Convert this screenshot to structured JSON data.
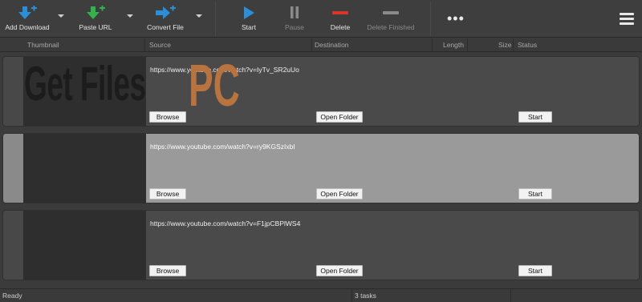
{
  "toolbar": {
    "add_download": "Add Download",
    "paste_url": "Paste URL",
    "convert_file": "Convert File",
    "start": "Start",
    "pause": "Pause",
    "delete": "Delete",
    "delete_finished": "Delete Finished",
    "more_icon": "more-dots-icon",
    "menu_icon": "hamburger-menu-icon",
    "colors": {
      "blue": "#2b8fd8",
      "green": "#2fb34a",
      "red": "#e0322b",
      "gray": "#8a8a8a"
    }
  },
  "columns": {
    "thumbnail": "Thumbnail",
    "source": "Source",
    "destination": "Destination",
    "length": "Length",
    "size": "Size",
    "status": "Status"
  },
  "watermark": {
    "text": "Get Files",
    "accent": "PC"
  },
  "rows": [
    {
      "url": "https://www.youtube.com/watch?v=IyTv_SR2uUo",
      "browse": "Browse",
      "open_folder": "Open Folder",
      "start": "Start"
    },
    {
      "url": "https://www.youtube.com/watch?v=ry9KGSzIxbI",
      "browse": "Browse",
      "open_folder": "Open Folder",
      "start": "Start"
    },
    {
      "url": "https://www.youtube.com/watch?v=F1jpCBPlWS4",
      "browse": "Browse",
      "open_folder": "Open Folder",
      "start": "Start"
    }
  ],
  "status": {
    "left": "Ready",
    "right": "3 tasks"
  }
}
